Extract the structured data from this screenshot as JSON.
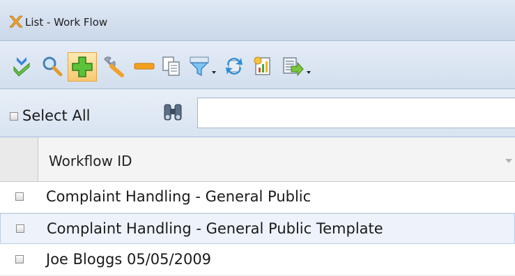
{
  "window": {
    "title": "List - Work Flow"
  },
  "toolbar": {
    "buttons": [
      {
        "icon": "download-check-icon"
      },
      {
        "icon": "search-icon"
      },
      {
        "icon": "add-icon",
        "active": true
      },
      {
        "icon": "wrench-icon"
      },
      {
        "icon": "remove-icon"
      },
      {
        "icon": "copy-icon"
      },
      {
        "icon": "filter-icon",
        "dropdown": true
      },
      {
        "icon": "refresh-icon"
      },
      {
        "icon": "report-icon"
      },
      {
        "icon": "export-icon",
        "dropdown": true
      }
    ]
  },
  "filter": {
    "select_all_label": "Select All",
    "search_value": ""
  },
  "grid": {
    "column_header": "Workflow ID",
    "rows": [
      {
        "label": "Complaint Handling - General Public",
        "selected": false
      },
      {
        "label": "Complaint Handling - General Public Template",
        "selected": true
      },
      {
        "label": "Joe Bloggs 05/05/2009",
        "selected": false
      }
    ]
  },
  "colors": {
    "accent": "#e3a33c",
    "header_bg": "#dfe8f4",
    "selection_bg": "#eef3fb"
  }
}
